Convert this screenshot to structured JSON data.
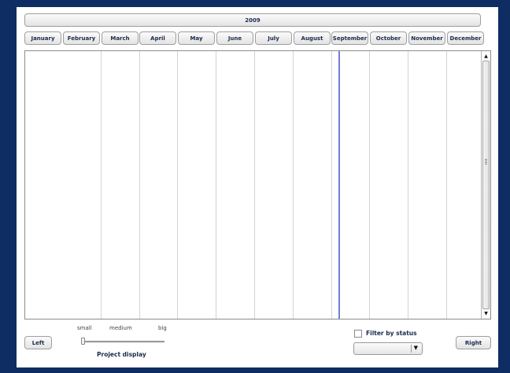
{
  "calendar": {
    "year": "2009",
    "months": [
      "January",
      "February",
      "March",
      "April",
      "May",
      "June",
      "July",
      "August",
      "September",
      "October",
      "November",
      "December"
    ]
  },
  "scrollbar": {
    "up_icon": "scroll-up-arrow-icon",
    "down_icon": "scroll-down-arrow-icon"
  },
  "controls": {
    "left_label": "Left",
    "right_label": "Right",
    "size_small": "small",
    "size_medium": "medium",
    "size_big": "big",
    "project_display": "Project display",
    "project_display_value": 0,
    "filter_label": "Filter by status",
    "filter_checked": false,
    "status_selected": ""
  },
  "colors": {
    "background": "#0e2d63",
    "current_date_line": "#6f7fd9"
  }
}
